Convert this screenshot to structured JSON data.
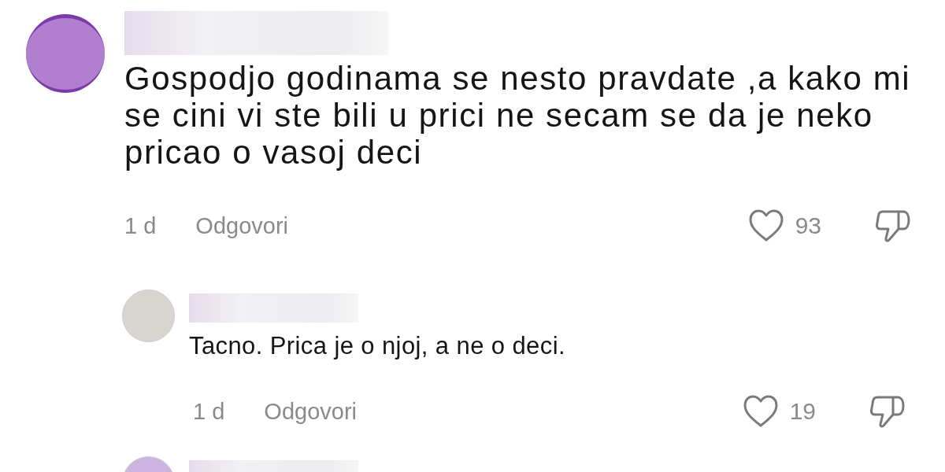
{
  "comments": [
    {
      "color": "#b07fd0",
      "text": "Gospodjo godinama se nesto pravdate ,a kako mi se cini vi ste bili u prici ne secam se da je neko pricao o vasoj deci",
      "time": "1 d",
      "reply_label": "Odgovori",
      "likes": "93",
      "replies": [
        {
          "color": "#d8d4d0",
          "text": "Tacno. Prica je o njoj, a ne o deci.",
          "time": "1 d",
          "reply_label": "Odgovori",
          "likes": "19"
        },
        {
          "color": "#cdb3e0"
        }
      ]
    }
  ]
}
